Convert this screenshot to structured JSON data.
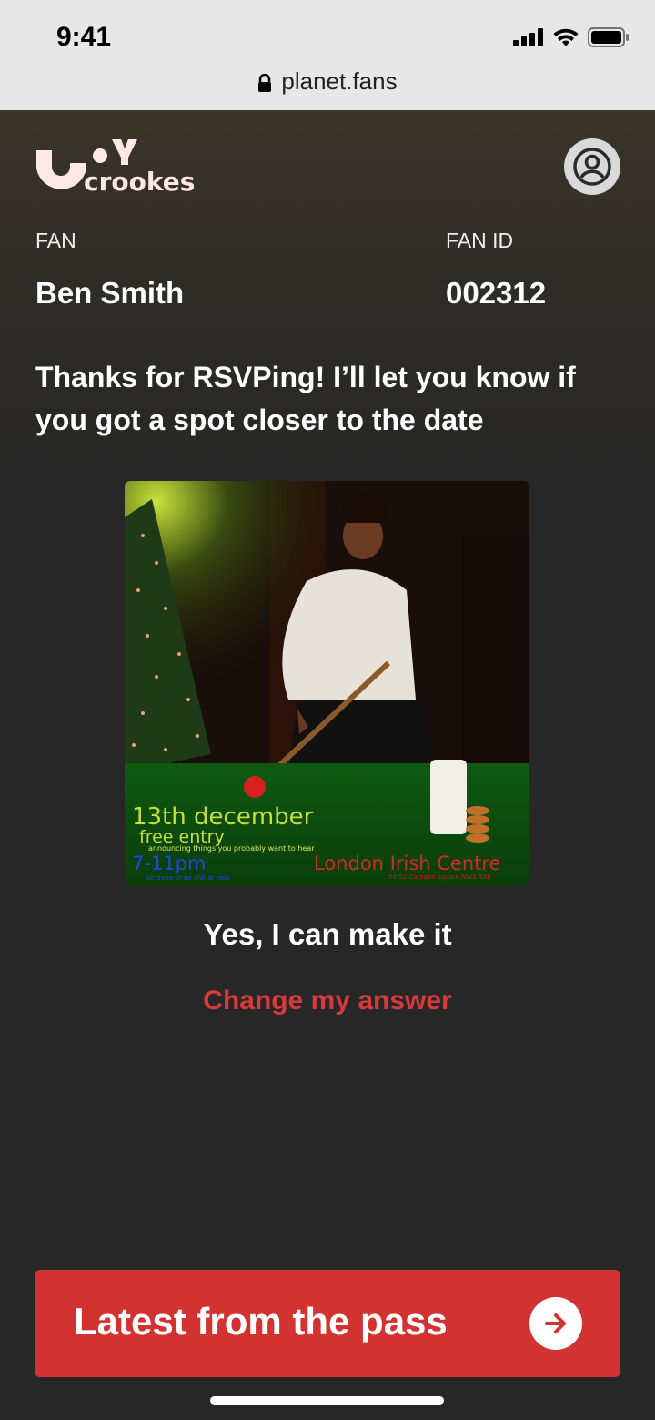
{
  "status_bar": {
    "time": "9:41",
    "url": "planet.fans"
  },
  "header": {
    "logo_text": "JOY crookes"
  },
  "fan": {
    "fan_label": "FAN",
    "fan_name": "Ben Smith",
    "id_label": "FAN ID",
    "id_value": "002312"
  },
  "message": "Thanks for RSVPing! I’ll let you know if you got a spot closer to the date",
  "poster": {
    "date": "13th december",
    "entry": "free entry",
    "tagline": "announcing things you probably want to hear",
    "time": "7-11pm",
    "subtag": "be there or be shit at pool",
    "venue": "London Irish Centre",
    "address": "50-52 Camden square NW1 9XB"
  },
  "answer": "Yes, I can make it",
  "change_answer": "Change my answer",
  "cta": {
    "label": "Latest from the pass",
    "icon": "arrow-right-icon"
  },
  "colors": {
    "accent": "#d33330",
    "change_link": "#d83a3a",
    "background": "#272727"
  }
}
